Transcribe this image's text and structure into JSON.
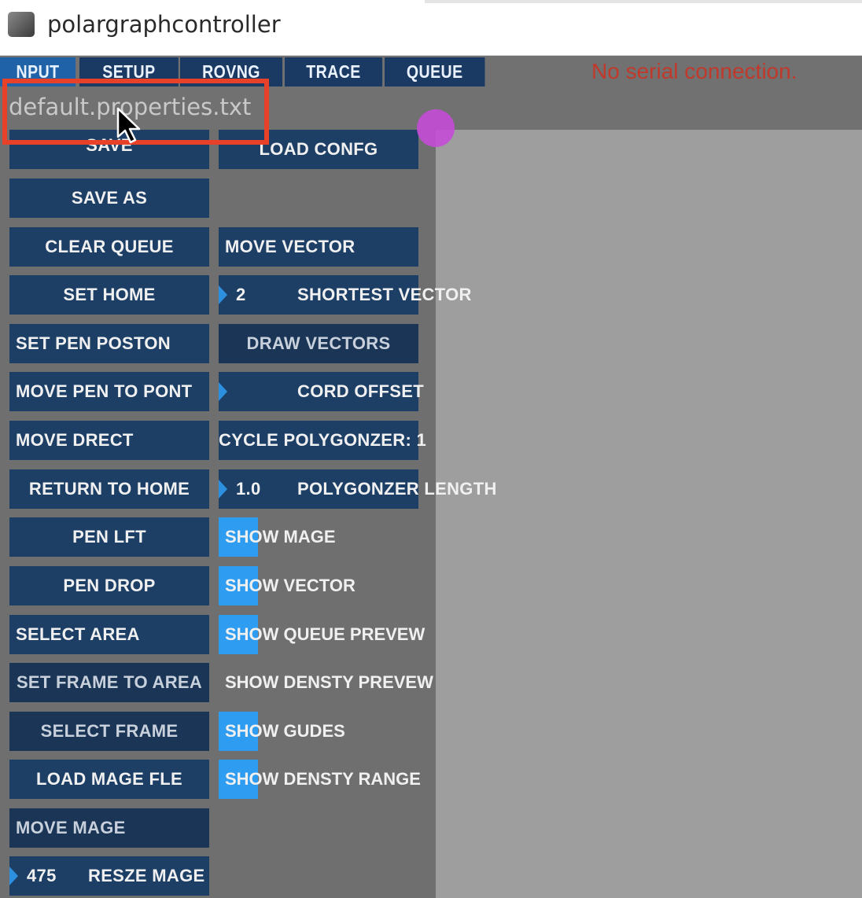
{
  "window": {
    "title": "polargraphcontroller"
  },
  "tabs": [
    {
      "label": "NPUT",
      "active": true
    },
    {
      "label": "SETUP",
      "active": false
    },
    {
      "label": "ROVNG",
      "active": false
    },
    {
      "label": "TRACE",
      "active": false
    },
    {
      "label": "QUEUE",
      "active": false
    }
  ],
  "status": {
    "text": "No serial connection."
  },
  "properties_file": "default.properties.txt",
  "left_buttons": {
    "save": "SAVE",
    "save_as": "SAVE AS",
    "clear_queue": "CLEAR QUEUE",
    "set_home": "SET HOME",
    "set_pen_position": "SET PEN POSTON",
    "move_pen_to_point": "MOVE PEN TO PONT",
    "move_direct": "MOVE DRECT",
    "return_to_home": "RETURN TO HOME",
    "pen_lift": "PEN LFT",
    "pen_drop": "PEN DROP",
    "select_area": "SELECT AREA",
    "set_frame_to_area": "SET FRAME TO AREA",
    "select_frame": "SELECT FRAME",
    "load_image_file": "LOAD MAGE FLE",
    "move_image": "MOVE MAGE",
    "resize_image": {
      "value": "475",
      "label": "RESZE MAGE"
    }
  },
  "right_buttons": {
    "load_config": "LOAD CONFG",
    "move_vector": "MOVE VECTOR",
    "shortest_vector": {
      "value": "2",
      "label": "SHORTEST VECTOR"
    },
    "draw_vectors": "DRAW VECTORS",
    "chord_offset": {
      "label": "CORD OFFSET"
    },
    "cycle_polygonizer": "CYCLE POLYGONZER: 1",
    "polygonizer_length": {
      "value": "1.0",
      "label": "POLYGONZER LENGTH"
    }
  },
  "toggles": [
    {
      "label": "SHOW MAGE",
      "on": true
    },
    {
      "label": "SHOW VECTOR",
      "on": true
    },
    {
      "label": "SHOW QUEUE PREVEW",
      "on": true
    },
    {
      "label": "SHOW DENSTY PREVEW",
      "on": false
    },
    {
      "label": "SHOW GUDES",
      "on": true
    },
    {
      "label": "SHOW DENSTY RANGE",
      "on": true
    }
  ],
  "colors": {
    "button_bg": "#1d3f66",
    "tab_active": "#1f62a8",
    "toggle_on": "#2e9cf0",
    "status_red": "#c0392b",
    "highlight": "#e8412a",
    "canvas": "#9e9e9e",
    "panel": "#6f6f6f"
  }
}
